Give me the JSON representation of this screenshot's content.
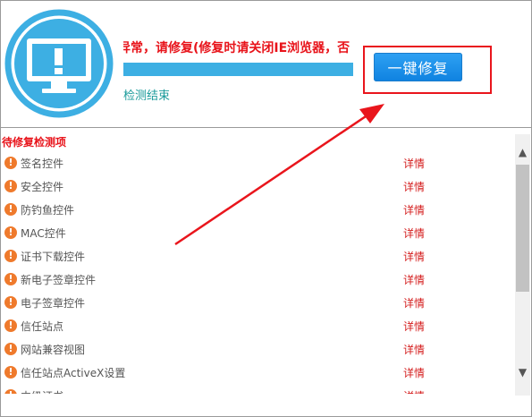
{
  "header": {
    "status_text": "异常，请修复(修复时请关闭IE浏览器，否",
    "progress_fraction": 1.0,
    "done_text": "检测结束",
    "fix_button_label": "一键修复"
  },
  "list": {
    "title": "待修复检测项",
    "items": [
      {
        "label": "签名控件",
        "detail": "详情"
      },
      {
        "label": "安全控件",
        "detail": "详情"
      },
      {
        "label": "防钓鱼控件",
        "detail": "详情"
      },
      {
        "label": "MAC控件",
        "detail": "详情"
      },
      {
        "label": "证书下载控件",
        "detail": "详情"
      },
      {
        "label": "新电子签章控件",
        "detail": "详情"
      },
      {
        "label": "电子签章控件",
        "detail": "详情"
      },
      {
        "label": "信任站点",
        "detail": "详情"
      },
      {
        "label": "网站兼容视图",
        "detail": "详情"
      },
      {
        "label": "信任站点ActiveX设置",
        "detail": "详情"
      },
      {
        "label": "中级证书",
        "detail": "详情"
      }
    ]
  },
  "icons": {
    "monitor": "monitor-warning-icon",
    "item_status": "warning-icon",
    "scroll_up": "chevron-up-icon",
    "scroll_down": "chevron-down-icon"
  },
  "colors": {
    "accent_blue": "#3dafe3",
    "alert_red": "#e8131a",
    "warning_orange": "#ef7a2c",
    "button_blue": "#1a8ee8"
  }
}
